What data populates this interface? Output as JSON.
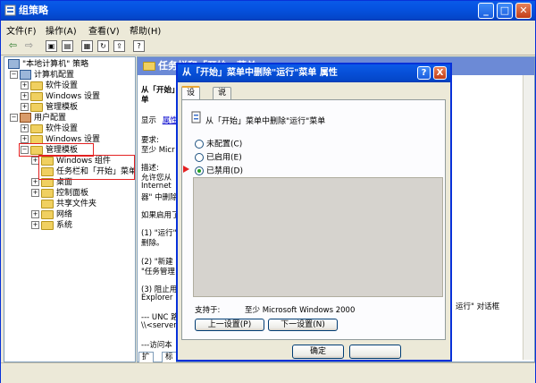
{
  "window": {
    "title": "组策略"
  },
  "menu": [
    "文件(F)",
    "操作(A)",
    "查看(V)",
    "帮助(H)"
  ],
  "toolbar_icons": [
    "back-icon",
    "forward-icon",
    "up-folder-icon",
    "show-tree-icon",
    "properties-icon",
    "refresh-icon",
    "export-icon",
    "help-icon"
  ],
  "tree": {
    "root": "\"本地计算机\" 策略",
    "computer_config": "计算机配置",
    "cc_software": "软件设置",
    "cc_windows": "Windows 设置",
    "cc_admin": "管理模板",
    "user_config": "用户配置",
    "uc_software": "软件设置",
    "uc_windows": "Windows 设置",
    "uc_admin": "管理模板",
    "windows_components": "Windows 组件",
    "taskbar_start": "任务栏和「开始」菜单",
    "desktop": "桌面",
    "control_panel": "控制面板",
    "shared_folders": "共享文件夹",
    "network": "网络",
    "system": "系统"
  },
  "right_panel": {
    "header": "任务栏和「开始」菜单",
    "setting_title_1": "从「开始」",
    "setting_title_2": "单",
    "display_label": "显示",
    "properties_link": "属性",
    "requirements_label": "要求:",
    "requirements_value": "至少 Micr",
    "description_label": "描述:",
    "desc_line1": "允许您从",
    "desc_line2": "Internet",
    "desc_line3": "器\" 中删除",
    "if_enable": "如果启用了",
    "item1_a": "(1) \"运行\"",
    "item1_b": "删除。",
    "item2_a": "(2) \"新建",
    "item2_b": "\"任务管理",
    "item3_a": "(3) 阻止用",
    "item3_b": "Explorer",
    "unc_a": "--- UNC 路",
    "unc_b": "\\\\<server",
    "access": "---访问本",
    "run_dialog_suffix": "运行\" 对话框",
    "tab_extended": "扩展",
    "tab_standard": "标"
  },
  "dialog": {
    "title": "从「开始」菜单中删除\"运行\"菜单 属性",
    "help_btn": "?",
    "close_btn": "X",
    "tab_settings": "设置",
    "tab_explain": "说明",
    "policy_name": "从「开始」菜单中删除\"运行\"菜单",
    "radio_not_configured": "未配置(C)",
    "radio_enabled": "已启用(E)",
    "radio_disabled": "已禁用(D)",
    "selected": "disabled",
    "supported_label": "支持于:",
    "supported_value": "至少 Microsoft Windows 2000",
    "prev_button": "上一设置(P)",
    "next_button": "下一设置(N)",
    "ok_button": "确定"
  }
}
